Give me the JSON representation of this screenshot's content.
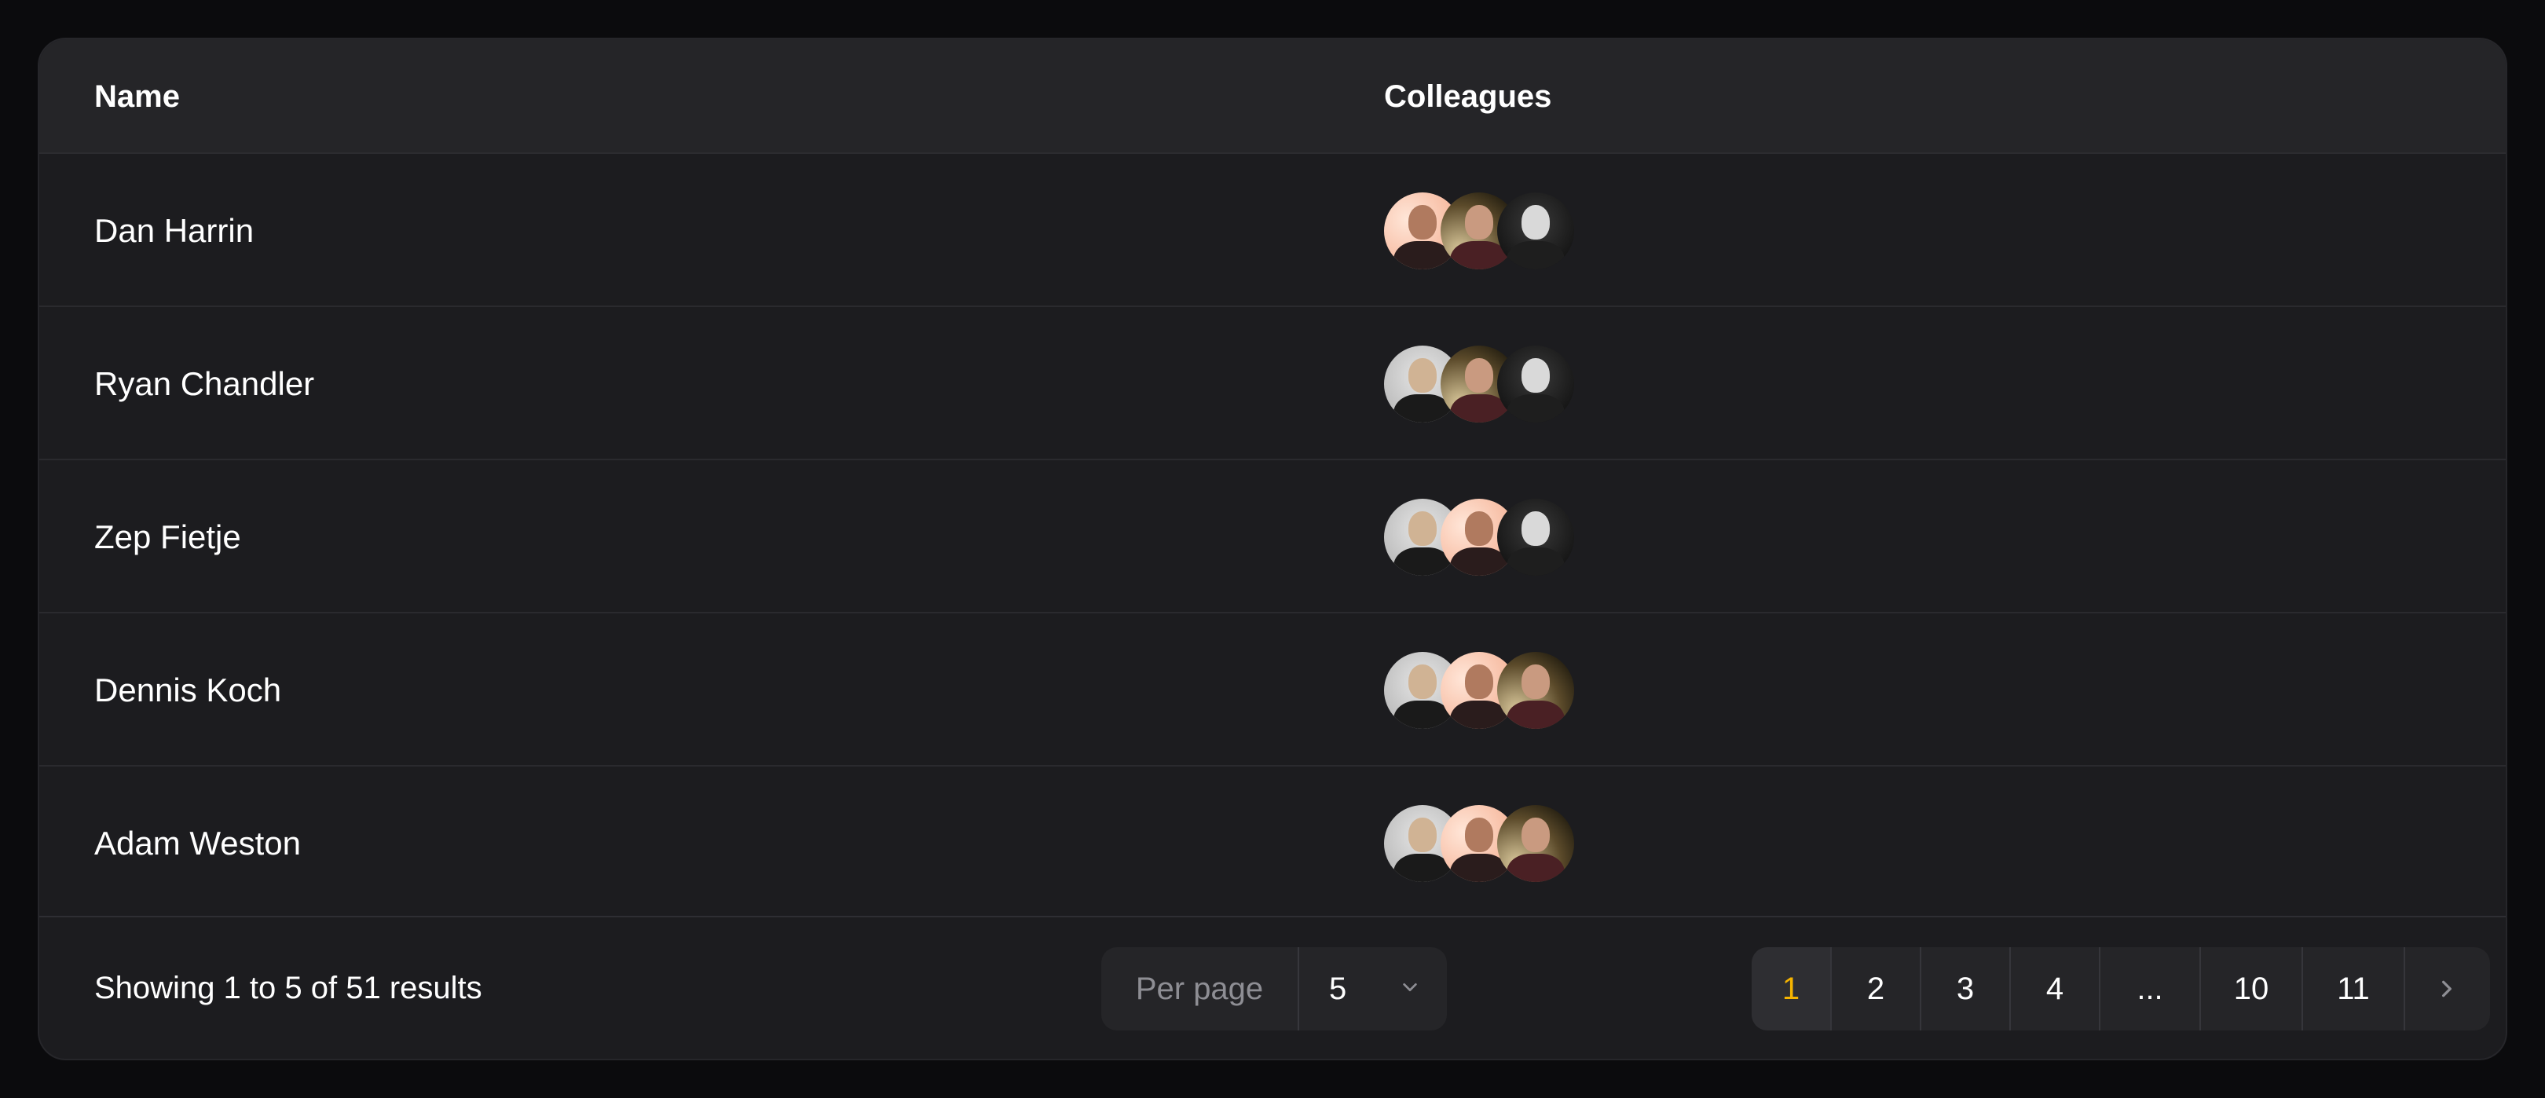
{
  "table": {
    "headers": {
      "name": "Name",
      "colleagues": "Colleagues"
    },
    "rows": [
      {
        "name": "Dan Harrin",
        "avatars": [
          "peach",
          "golden",
          "dark"
        ]
      },
      {
        "name": "Ryan Chandler",
        "avatars": [
          "gray",
          "golden",
          "dark"
        ]
      },
      {
        "name": "Zep Fietje",
        "avatars": [
          "gray",
          "peach",
          "dark"
        ]
      },
      {
        "name": "Dennis Koch",
        "avatars": [
          "gray",
          "peach",
          "golden"
        ]
      },
      {
        "name": "Adam Weston",
        "avatars": [
          "gray",
          "peach",
          "golden"
        ]
      }
    ]
  },
  "footer": {
    "showing": "Showing 1 to 5 of 51 results",
    "per_page_label": "Per page",
    "per_page_value": "5",
    "pages": [
      "1",
      "2",
      "3",
      "4",
      "...",
      "10",
      "11"
    ],
    "active_page": "1",
    "next_icon": "chevron-right-icon"
  },
  "colors": {
    "background": "#0b0b0d",
    "card": "#1c1c1f",
    "header": "#252528",
    "active_page": "#f5b400"
  }
}
